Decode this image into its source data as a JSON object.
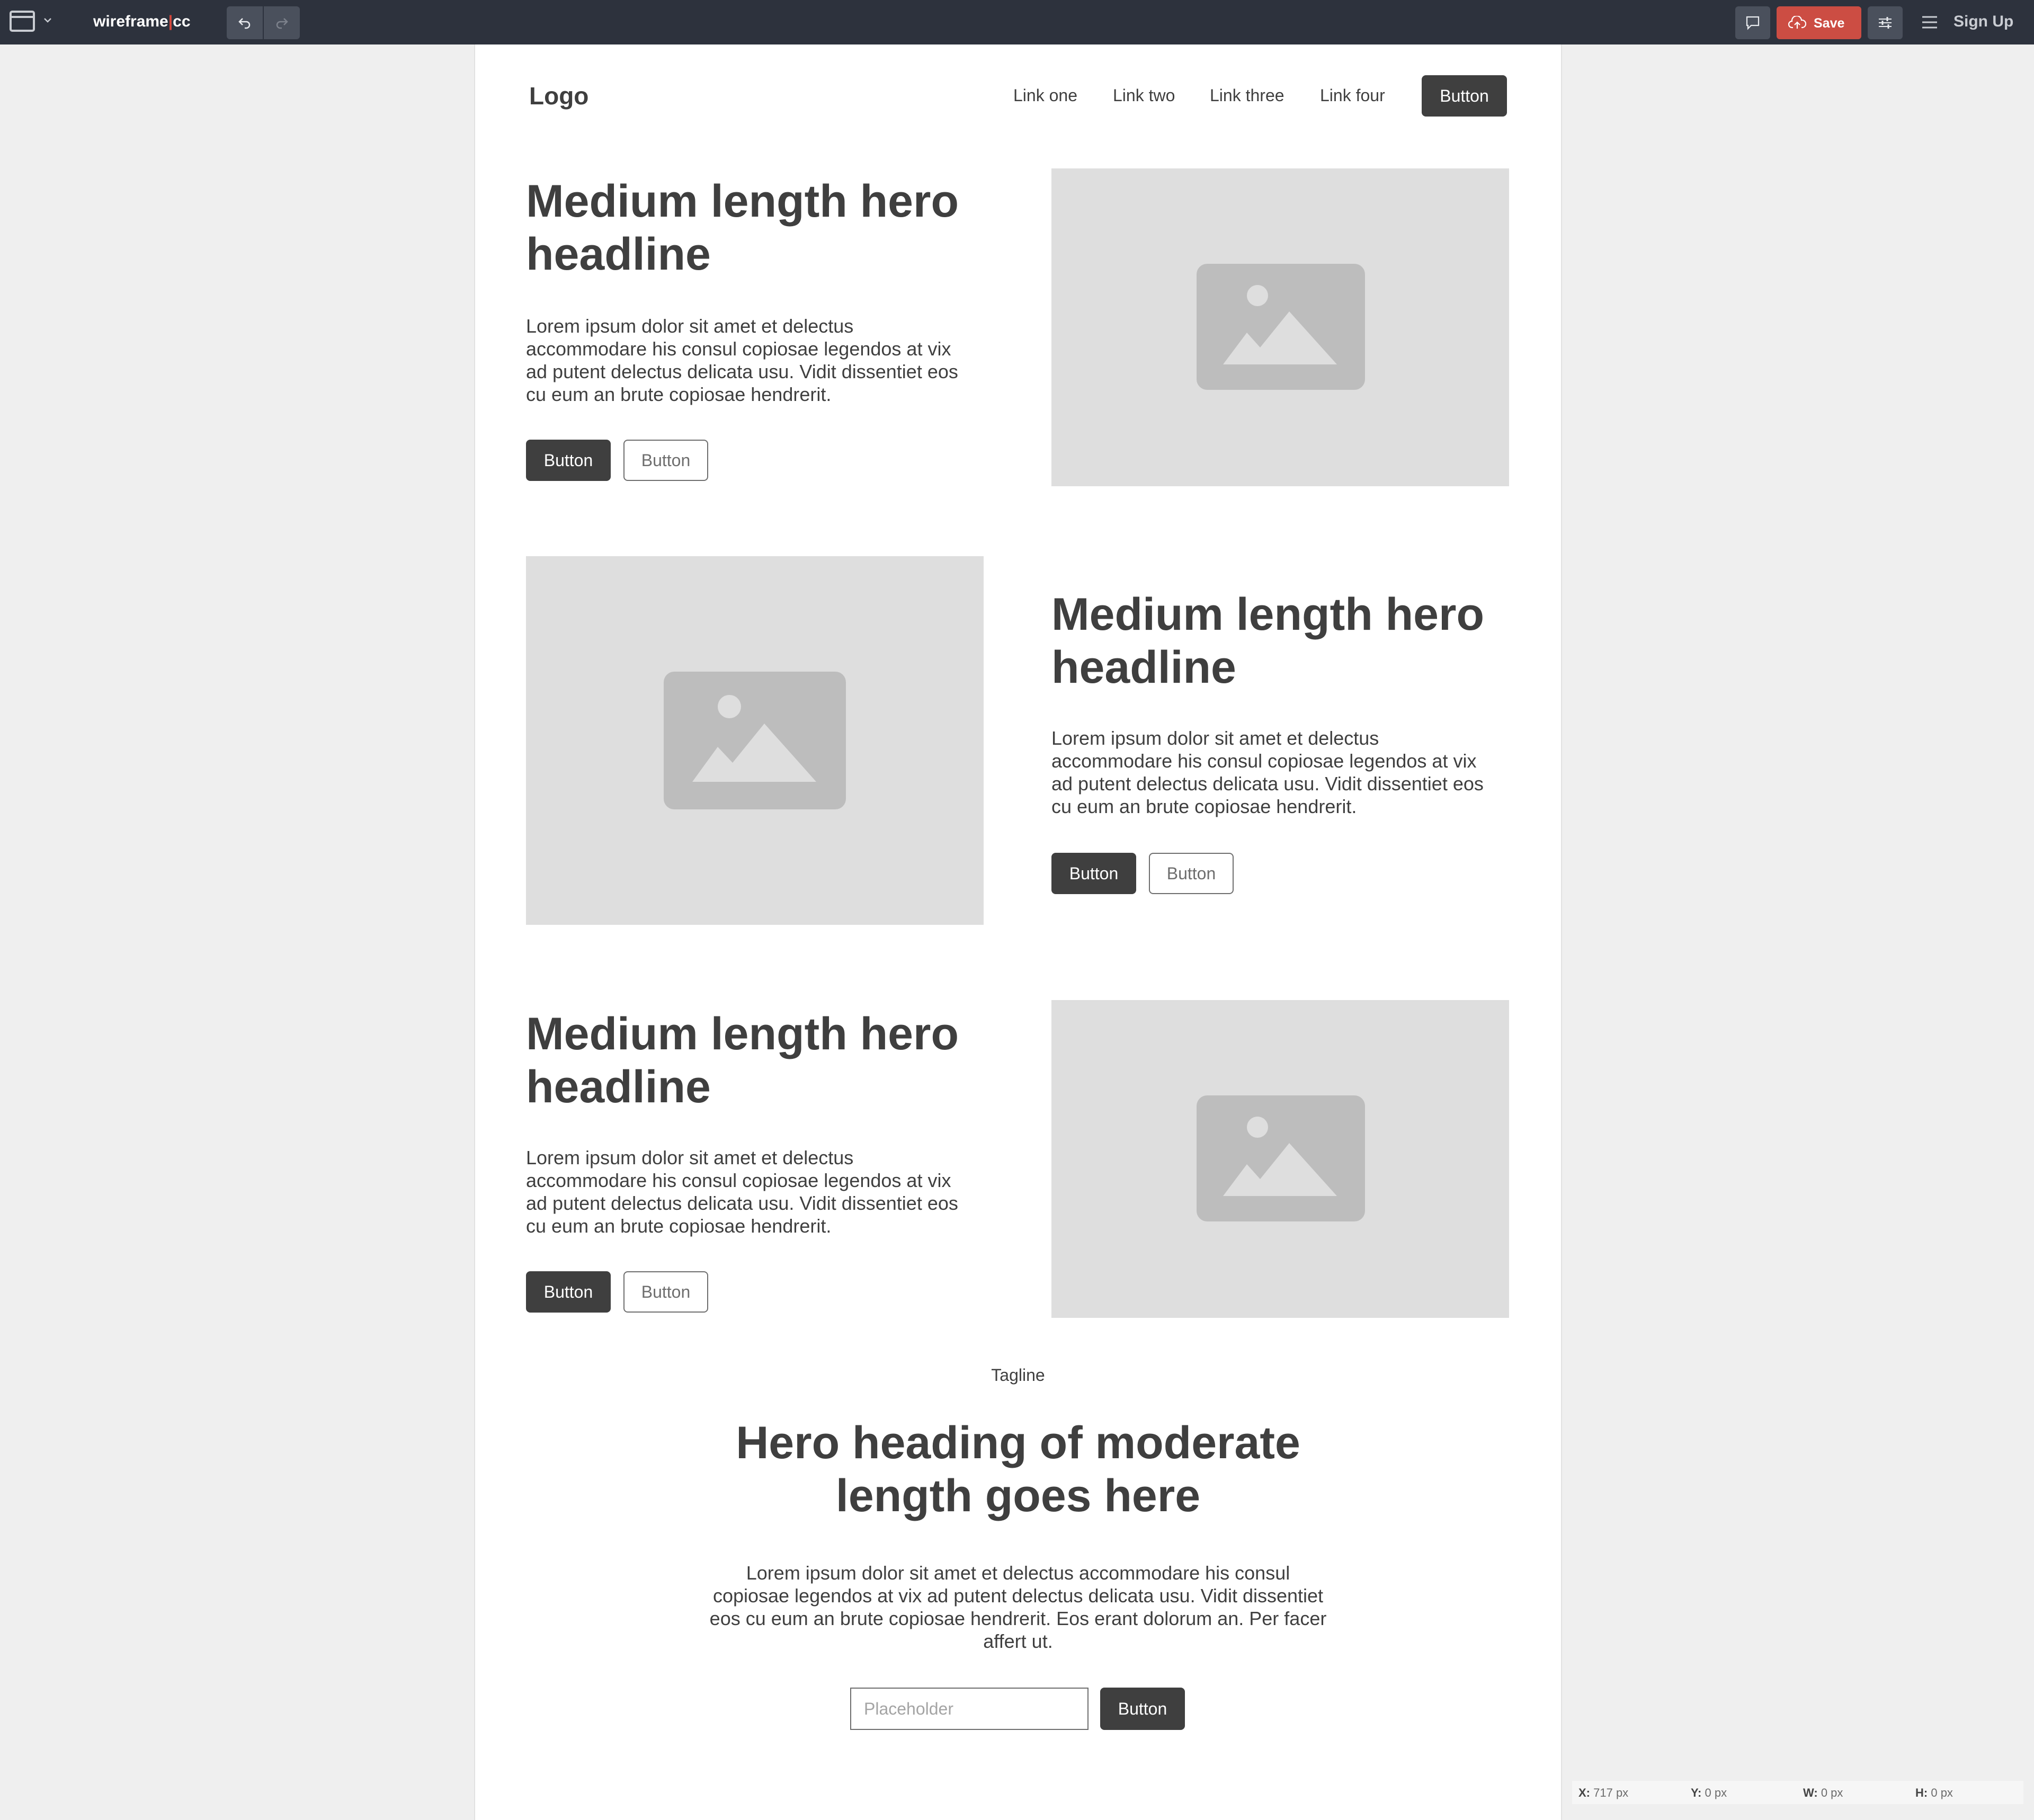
{
  "toolbar": {
    "brand_prefix": "wireframe",
    "brand_sep": "|",
    "brand_suffix": "cc",
    "save_label": "Save",
    "signup_label": "Sign Up",
    "icons": [
      "window-icon",
      "chevron-down-icon",
      "undo-icon",
      "redo-icon",
      "comment-icon",
      "cloud-upload-icon",
      "sliders-icon",
      "hamburger-menu-icon"
    ]
  },
  "nav": {
    "logo": "Logo",
    "links": [
      "Link one",
      "Link two",
      "Link three",
      "Link four"
    ],
    "button": "Button"
  },
  "sections": [
    {
      "headline": "Medium length hero headline",
      "body": "Lorem ipsum dolor sit amet et delectus accommodare his consul copiosae legendos at vix ad putent delectus delicata usu. Vidit dissentiet eos cu eum an brute copiosae hendrerit.",
      "primary_button": "Button",
      "secondary_button": "Button"
    },
    {
      "headline": "Medium length hero headline",
      "body": "Lorem ipsum dolor sit amet et delectus accommodare his consul copiosae legendos at vix ad putent delectus delicata usu. Vidit dissentiet eos cu eum an brute copiosae hendrerit.",
      "primary_button": "Button",
      "secondary_button": "Button"
    },
    {
      "headline": "Medium length hero headline",
      "body": "Lorem ipsum dolor sit amet et delectus accommodare his consul copiosae legendos at vix ad putent delectus delicata usu. Vidit dissentiet eos cu eum an brute copiosae hendrerit.",
      "primary_button": "Button",
      "secondary_button": "Button"
    }
  ],
  "cta": {
    "tagline": "Tagline",
    "heading": "Hero heading of moderate length goes here",
    "body": "Lorem ipsum dolor sit amet et delectus accommodare his consul copiosae legendos at vix ad putent delectus delicata usu. Vidit dissentiet eos cu eum an brute copiosae hendrerit. Eos erant dolorum an. Per facer affert ut.",
    "input_placeholder": "Placeholder",
    "button": "Button"
  },
  "status": {
    "x_label": "X:",
    "x_value": "717 px",
    "y_label": "Y:",
    "y_value": "0 px",
    "w_label": "W:",
    "w_value": "0 px",
    "h_label": "H:",
    "h_value": "0 px"
  },
  "colors": {
    "topbar": "#2d323d",
    "save": "#cc4d43",
    "dark_button": "#3f3f3f",
    "image_placeholder": "#dedede",
    "canvas_bg": "#efefef"
  }
}
